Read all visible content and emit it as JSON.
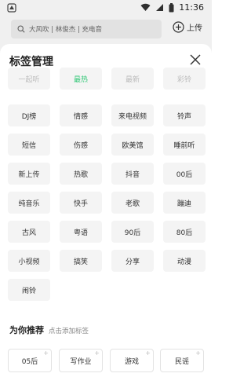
{
  "status_bar": {
    "time": "11:36"
  },
  "app_header": {
    "search_text": "大风吹 | 林俊杰 | 充电音",
    "upload_label": "上传"
  },
  "sheet": {
    "title": "标签管理",
    "tags": [
      {
        "label": "一起听",
        "state": "faded"
      },
      {
        "label": "最热",
        "state": "active"
      },
      {
        "label": "最新",
        "state": "faded"
      },
      {
        "label": "彩铃",
        "state": "faded"
      },
      {
        "label": "DJ榜",
        "state": "normal"
      },
      {
        "label": "情感",
        "state": "normal"
      },
      {
        "label": "来电视频",
        "state": "normal"
      },
      {
        "label": "铃声",
        "state": "normal"
      },
      {
        "label": "短信",
        "state": "normal"
      },
      {
        "label": "伤感",
        "state": "normal"
      },
      {
        "label": "欧美馆",
        "state": "normal"
      },
      {
        "label": "睡前听",
        "state": "normal"
      },
      {
        "label": "新上传",
        "state": "normal"
      },
      {
        "label": "热歌",
        "state": "normal"
      },
      {
        "label": "抖音",
        "state": "normal"
      },
      {
        "label": "00后",
        "state": "normal"
      },
      {
        "label": "纯音乐",
        "state": "normal"
      },
      {
        "label": "快手",
        "state": "normal"
      },
      {
        "label": "老歌",
        "state": "normal"
      },
      {
        "label": "蹦迪",
        "state": "normal"
      },
      {
        "label": "古风",
        "state": "normal"
      },
      {
        "label": "粤语",
        "state": "normal"
      },
      {
        "label": "90后",
        "state": "normal"
      },
      {
        "label": "80后",
        "state": "normal"
      },
      {
        "label": "小视频",
        "state": "normal"
      },
      {
        "label": "搞笑",
        "state": "normal"
      },
      {
        "label": "分享",
        "state": "normal"
      },
      {
        "label": "动漫",
        "state": "normal"
      },
      {
        "label": "闹铃",
        "state": "normal"
      }
    ],
    "recommend_title": "为你推荐",
    "recommend_subtitle": "点击添加标签",
    "recommend_tags": [
      "05后",
      "写作业",
      "游戏",
      "民谣"
    ],
    "plus_glyph": "+"
  },
  "colors": {
    "active": "#34c878",
    "faded": "#bbbbbb",
    "tag_bg": "#f4f4f4"
  }
}
